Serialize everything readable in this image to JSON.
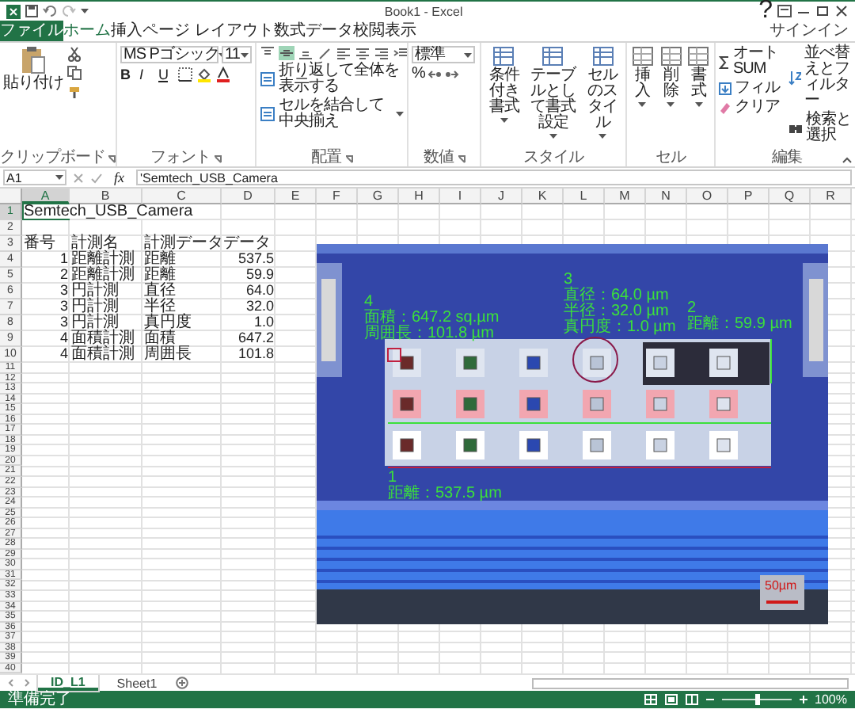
{
  "window": {
    "title": "Book1 - Excel",
    "help": "?",
    "sign_in": "サインイン"
  },
  "tabs": [
    {
      "label": "ファイル",
      "kind": "file",
      "selected": false
    },
    {
      "label": "ホーム",
      "kind": "tab",
      "selected": true
    },
    {
      "label": "挿入",
      "kind": "tab",
      "selected": false
    },
    {
      "label": "ページ レイアウト",
      "kind": "tab",
      "selected": false
    },
    {
      "label": "数式",
      "kind": "tab",
      "selected": false
    },
    {
      "label": "データ",
      "kind": "tab",
      "selected": false
    },
    {
      "label": "校閲",
      "kind": "tab",
      "selected": false
    },
    {
      "label": "表示",
      "kind": "tab",
      "selected": false
    }
  ],
  "ribbon": {
    "clipboard": {
      "paste": "貼り付け",
      "label": "クリップボード"
    },
    "font": {
      "name": "MS Pゴシック",
      "size": "11",
      "format_buttons": [
        "B",
        "I",
        "U"
      ],
      "label": "フォント"
    },
    "alignment": {
      "wrap": "折り返して全体を表示する",
      "merge": "セルを結合して中央揃え",
      "label": "配置"
    },
    "number": {
      "format": "標準",
      "percent": "%",
      "label": "数値"
    },
    "styles": {
      "buttons": [
        "条件付き書式",
        "テーブルとして書式設定",
        "セルのスタイル"
      ],
      "label": "スタイル"
    },
    "cells": {
      "buttons": [
        "挿入",
        "削除",
        "書式"
      ],
      "label": "セル"
    },
    "editing": {
      "small": [
        "オート SUM",
        "フィル",
        "クリア"
      ],
      "buttons": [
        "並べ替えとフィルター",
        "検索と選択"
      ],
      "label": "編集"
    }
  },
  "formula_bar": {
    "name_box": "A1",
    "function_label": "fx",
    "value": "'Semtech_USB_Camera"
  },
  "sheet": {
    "columns": [
      {
        "label": "A",
        "selected": true
      },
      {
        "label": "B",
        "selected": false
      },
      {
        "label": "C",
        "selected": false
      },
      {
        "label": "D",
        "selected": false
      },
      {
        "label": "E",
        "selected": false
      },
      {
        "label": "F",
        "selected": false
      },
      {
        "label": "G",
        "selected": false
      },
      {
        "label": "H",
        "selected": false
      },
      {
        "label": "I",
        "selected": false
      },
      {
        "label": "J",
        "selected": false
      },
      {
        "label": "K",
        "selected": false
      },
      {
        "label": "L",
        "selected": false
      },
      {
        "label": "M",
        "selected": false
      },
      {
        "label": "N",
        "selected": false
      },
      {
        "label": "O",
        "selected": false
      },
      {
        "label": "P",
        "selected": false
      },
      {
        "label": "Q",
        "selected": false
      },
      {
        "label": "R",
        "selected": false
      }
    ],
    "rows": [
      {
        "number": "1",
        "selected": true,
        "cells": {
          "A": {
            "value": "Semtech_USB_Camera",
            "kind": "text",
            "selected": true
          }
        }
      },
      {
        "number": "2",
        "selected": false
      },
      {
        "number": "3",
        "selected": false,
        "cells": {
          "A": {
            "value": "番号",
            "kind": "text",
            "selected": false
          },
          "B": {
            "value": "計測名",
            "kind": "text",
            "selected": false
          },
          "C": {
            "value": "計測データ",
            "kind": "text",
            "selected": false
          },
          "D": {
            "value": "データ",
            "kind": "text",
            "selected": false
          }
        }
      },
      {
        "number": "4",
        "selected": false,
        "cells": {
          "A": {
            "value": "1",
            "kind": "number",
            "selected": false
          },
          "B": {
            "value": "距離計測",
            "kind": "text",
            "selected": false
          },
          "C": {
            "value": "距離",
            "kind": "text",
            "selected": false
          },
          "D": {
            "value": "537.5",
            "kind": "number",
            "selected": false
          }
        }
      },
      {
        "number": "5",
        "selected": false,
        "cells": {
          "A": {
            "value": "2",
            "kind": "number",
            "selected": false
          },
          "B": {
            "value": "距離計測",
            "kind": "text",
            "selected": false
          },
          "C": {
            "value": "距離",
            "kind": "text",
            "selected": false
          },
          "D": {
            "value": "59.9",
            "kind": "number",
            "selected": false
          }
        }
      },
      {
        "number": "6",
        "selected": false,
        "cells": {
          "A": {
            "value": "3",
            "kind": "number",
            "selected": false
          },
          "B": {
            "value": "円計測",
            "kind": "text",
            "selected": false
          },
          "C": {
            "value": "直径",
            "kind": "text",
            "selected": false
          },
          "D": {
            "value": "64.0",
            "kind": "number",
            "selected": false
          }
        }
      },
      {
        "number": "7",
        "selected": false,
        "cells": {
          "A": {
            "value": "3",
            "kind": "number",
            "selected": false
          },
          "B": {
            "value": "円計測",
            "kind": "text",
            "selected": false
          },
          "C": {
            "value": "半径",
            "kind": "text",
            "selected": false
          },
          "D": {
            "value": "32.0",
            "kind": "number",
            "selected": false
          }
        }
      },
      {
        "number": "8",
        "selected": false,
        "cells": {
          "A": {
            "value": "3",
            "kind": "number",
            "selected": false
          },
          "B": {
            "value": "円計測",
            "kind": "text",
            "selected": false
          },
          "C": {
            "value": "真円度",
            "kind": "text",
            "selected": false
          },
          "D": {
            "value": "1.0",
            "kind": "number",
            "selected": false
          }
        }
      },
      {
        "number": "9",
        "selected": false,
        "cells": {
          "A": {
            "value": "4",
            "kind": "number",
            "selected": false
          },
          "B": {
            "value": "面積計測",
            "kind": "text",
            "selected": false
          },
          "C": {
            "value": "面積",
            "kind": "text",
            "selected": false
          },
          "D": {
            "value": "647.2",
            "kind": "number",
            "selected": false
          }
        }
      },
      {
        "number": "10",
        "selected": false,
        "cells": {
          "A": {
            "value": "4",
            "kind": "number",
            "selected": false
          },
          "B": {
            "value": "面積計測",
            "kind": "text",
            "selected": false
          },
          "C": {
            "value": "周囲長",
            "kind": "text",
            "selected": false
          },
          "D": {
            "value": "101.8",
            "kind": "number",
            "selected": false
          }
        }
      },
      {
        "number": "11",
        "selected": false
      },
      {
        "number": "12",
        "selected": false
      },
      {
        "number": "13",
        "selected": false
      },
      {
        "number": "14",
        "selected": false
      },
      {
        "number": "15",
        "selected": false
      },
      {
        "number": "16",
        "selected": false
      },
      {
        "number": "17",
        "selected": false
      },
      {
        "number": "18",
        "selected": false
      },
      {
        "number": "19",
        "selected": false
      },
      {
        "number": "20",
        "selected": false
      },
      {
        "number": "21",
        "selected": false
      },
      {
        "number": "22",
        "selected": false
      },
      {
        "number": "23",
        "selected": false
      },
      {
        "number": "24",
        "selected": false
      },
      {
        "number": "25",
        "selected": false
      },
      {
        "number": "26",
        "selected": false
      },
      {
        "number": "27",
        "selected": false
      },
      {
        "number": "28",
        "selected": false
      },
      {
        "number": "29",
        "selected": false
      },
      {
        "number": "30",
        "selected": false
      },
      {
        "number": "31",
        "selected": false
      },
      {
        "number": "32",
        "selected": false
      },
      {
        "number": "33",
        "selected": false
      },
      {
        "number": "34",
        "selected": false
      },
      {
        "number": "35",
        "selected": false
      },
      {
        "number": "36",
        "selected": false
      },
      {
        "number": "37",
        "selected": false
      },
      {
        "number": "38",
        "selected": false
      },
      {
        "number": "39",
        "selected": false
      },
      {
        "number": "40",
        "selected": false
      }
    ],
    "embedded_image": {
      "annotations": [
        {
          "lines": [
            "4",
            "面積：647.2 sq.µm",
            "周囲長：101.8 µm"
          ]
        },
        {
          "lines": [
            "3",
            "直径：64.0 µm",
            "半径：32.0 µm",
            "真円度：1.0 µm"
          ]
        },
        {
          "lines": [
            "2",
            "距離：59.9 µm"
          ]
        },
        {
          "lines": [
            "1",
            "距離：537.5 µm"
          ]
        }
      ],
      "scale_bar": "50µm"
    }
  },
  "sheet_tabs": [
    {
      "label": "ID_L1",
      "selected": true
    },
    {
      "label": "Sheet1",
      "selected": false
    }
  ],
  "status_bar": {
    "text": "準備完了",
    "zoom": {
      "level": 0.5,
      "reading": "100%"
    }
  }
}
